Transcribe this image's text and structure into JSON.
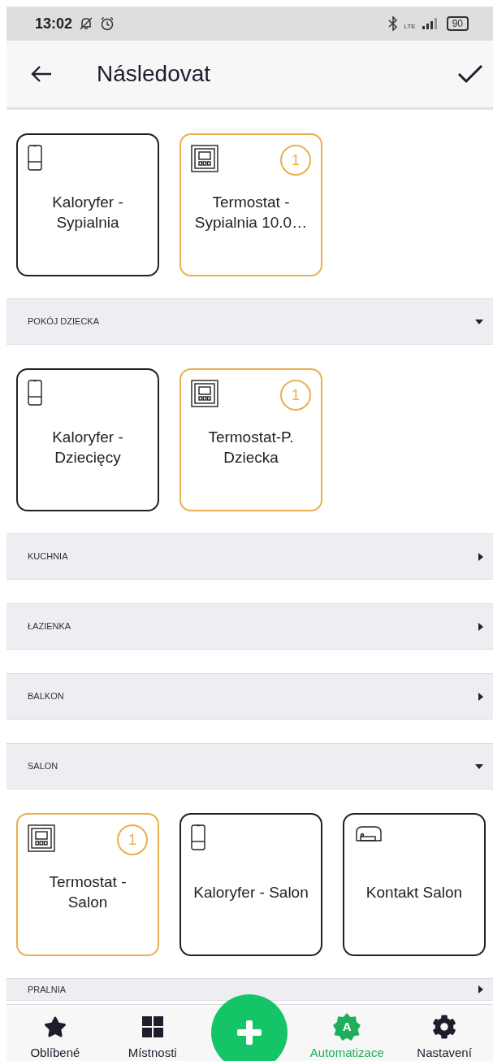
{
  "status_bar": {
    "time": "13:02",
    "network": "LTE",
    "battery": "90"
  },
  "header": {
    "title": "Následovat"
  },
  "top_devices": [
    {
      "name": "Kaloryfer - Sypialnia",
      "kind": "radiator",
      "highlighted": false
    },
    {
      "name": "Termostat - Sypialnia 10.0…",
      "kind": "thermostat",
      "highlighted": true,
      "badge": "1"
    }
  ],
  "sections": [
    {
      "name": "POKÓJ DZIECKA",
      "expanded": true,
      "devices": [
        {
          "name": "Kaloryfer - Dziecięcy",
          "kind": "radiator",
          "highlighted": false
        },
        {
          "name": "Termostat-P. Dziecka",
          "kind": "thermostat",
          "highlighted": true,
          "badge": "1"
        }
      ]
    },
    {
      "name": "KUCHNIA",
      "expanded": false
    },
    {
      "name": "ŁAZIENKA",
      "expanded": false
    },
    {
      "name": "BALKON",
      "expanded": false
    },
    {
      "name": "SALON",
      "expanded": true,
      "devices": [
        {
          "name": "Termostat - Salon",
          "kind": "thermostat",
          "highlighted": true,
          "badge": "1"
        },
        {
          "name": "Kaloryfer - Salon",
          "kind": "radiator",
          "highlighted": false
        },
        {
          "name": "Kontakt Salon",
          "kind": "contact",
          "highlighted": false
        }
      ]
    },
    {
      "name": "PRALNIA",
      "expanded": false
    }
  ],
  "bottom_nav": [
    {
      "label": "Oblíbené",
      "kind": "star",
      "selected": false
    },
    {
      "label": "Místnosti",
      "kind": "grid",
      "selected": false
    },
    {
      "kind": "add",
      "selected": false
    },
    {
      "label": "Automatizace",
      "kind": "automation",
      "icon_text": "A",
      "selected": true
    },
    {
      "label": "Nastavení",
      "kind": "gear",
      "selected": false
    }
  ]
}
